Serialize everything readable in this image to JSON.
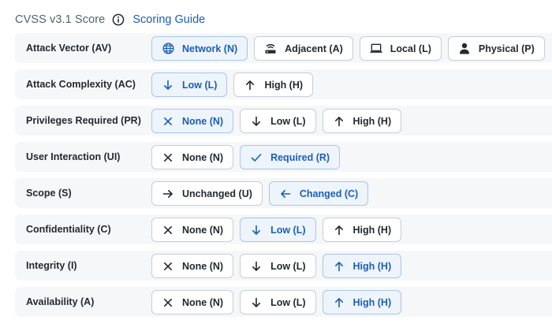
{
  "header": {
    "title": "CVSS v3.1 Score",
    "info_icon": "info-icon",
    "guide_link": "Scoring Guide"
  },
  "colors": {
    "accent": "#1a5fb4",
    "selected_bg": "#eef4fb",
    "row_bg": "#f6f7f8",
    "border": "#c9cdd2"
  },
  "metrics": [
    {
      "label": "Attack Vector (AV)",
      "options": [
        {
          "label": "Network (N)",
          "icon": "globe",
          "selected": true
        },
        {
          "label": "Adjacent (A)",
          "icon": "router",
          "selected": false
        },
        {
          "label": "Local (L)",
          "icon": "laptop",
          "selected": false
        },
        {
          "label": "Physical (P)",
          "icon": "person",
          "selected": false
        }
      ]
    },
    {
      "label": "Attack Complexity (AC)",
      "options": [
        {
          "label": "Low (L)",
          "icon": "arrow-down",
          "selected": true
        },
        {
          "label": "High (H)",
          "icon": "arrow-up",
          "selected": false
        }
      ]
    },
    {
      "label": "Privileges Required (PR)",
      "options": [
        {
          "label": "None (N)",
          "icon": "x",
          "selected": true
        },
        {
          "label": "Low (L)",
          "icon": "arrow-down",
          "selected": false
        },
        {
          "label": "High (H)",
          "icon": "arrow-up",
          "selected": false
        }
      ]
    },
    {
      "label": "User Interaction (UI)",
      "options": [
        {
          "label": "None (N)",
          "icon": "x",
          "selected": false
        },
        {
          "label": "Required (R)",
          "icon": "check",
          "selected": true
        }
      ]
    },
    {
      "label": "Scope (S)",
      "options": [
        {
          "label": "Unchanged (U)",
          "icon": "arrow-right",
          "selected": false
        },
        {
          "label": "Changed (C)",
          "icon": "arrow-left",
          "selected": true
        }
      ]
    },
    {
      "label": "Confidentiality (C)",
      "options": [
        {
          "label": "None (N)",
          "icon": "x",
          "selected": false
        },
        {
          "label": "Low (L)",
          "icon": "arrow-down",
          "selected": true
        },
        {
          "label": "High (H)",
          "icon": "arrow-up",
          "selected": false
        }
      ]
    },
    {
      "label": "Integrity (I)",
      "options": [
        {
          "label": "None (N)",
          "icon": "x",
          "selected": false
        },
        {
          "label": "Low (L)",
          "icon": "arrow-down",
          "selected": false
        },
        {
          "label": "High (H)",
          "icon": "arrow-up",
          "selected": true
        }
      ]
    },
    {
      "label": "Availability (A)",
      "options": [
        {
          "label": "None (N)",
          "icon": "x",
          "selected": false
        },
        {
          "label": "Low (L)",
          "icon": "arrow-down",
          "selected": false
        },
        {
          "label": "High (H)",
          "icon": "arrow-up",
          "selected": true
        }
      ]
    }
  ]
}
